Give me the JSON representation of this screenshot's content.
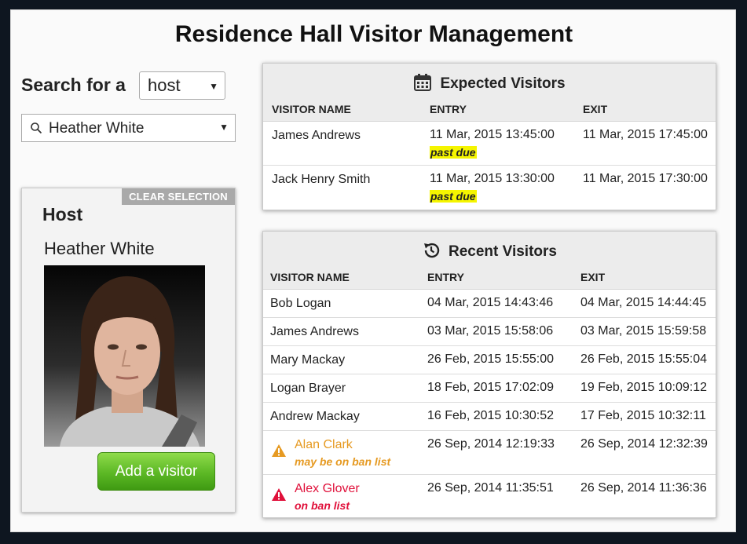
{
  "app_title": "Residence Hall Visitor Management",
  "search": {
    "label": "Search for a",
    "type_value": "host",
    "query_value": "Heather White"
  },
  "host_card": {
    "clear_label": "CLEAR SELECTION",
    "heading": "Host",
    "name": "Heather White",
    "add_visitor_label": "Add a visitor"
  },
  "expected": {
    "title": "Expected Visitors",
    "icon": "calendar-icon",
    "columns": [
      "VISITOR NAME",
      "ENTRY",
      "EXIT"
    ],
    "rows": [
      {
        "name": "James Andrews",
        "entry": "11 Mar, 2015 13:45:00",
        "exit": "11 Mar, 2015 17:45:00",
        "status": "past due"
      },
      {
        "name": "Jack Henry Smith",
        "entry": "11 Mar, 2015 13:30:00",
        "exit": "11 Mar, 2015 17:30:00",
        "status": "past due"
      }
    ]
  },
  "recent": {
    "title": "Recent Visitors",
    "icon": "history-icon",
    "columns": [
      "VISITOR NAME",
      "ENTRY",
      "EXIT"
    ],
    "rows": [
      {
        "name": "Bob Logan",
        "entry": "04 Mar, 2015 14:43:46",
        "exit": "04 Mar, 2015 14:44:45"
      },
      {
        "name": "James Andrews",
        "entry": "03 Mar, 2015 15:58:06",
        "exit": "03 Mar, 2015 15:59:58"
      },
      {
        "name": "Mary Mackay",
        "entry": "26 Feb, 2015 15:55:00",
        "exit": "26 Feb, 2015 15:55:04"
      },
      {
        "name": "Logan Brayer",
        "entry": "18 Feb, 2015 17:02:09",
        "exit": "19 Feb, 2015 10:09:12"
      },
      {
        "name": "Andrew Mackay",
        "entry": "16 Feb, 2015 10:30:52",
        "exit": "17 Feb, 2015 10:32:11"
      },
      {
        "name": "Alan Clark",
        "entry": "26 Sep, 2014 12:19:33",
        "exit": "26 Sep, 2014 12:32:39",
        "warning": "may be on ban list"
      },
      {
        "name": "Alex Glover",
        "entry": "26 Sep, 2014 11:35:51",
        "exit": "26 Sep, 2014 11:36:36",
        "warning": "on ban list"
      }
    ]
  },
  "colors": {
    "warning": "#e69a22",
    "ban": "#e0103a",
    "past_due_highlight": "#f5f500",
    "add_button": "#5cb825"
  }
}
